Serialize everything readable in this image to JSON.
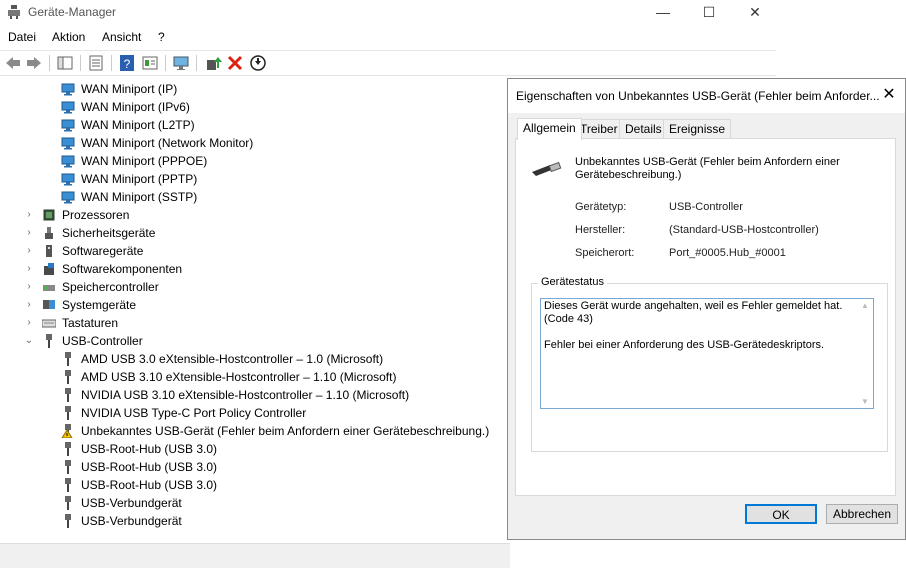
{
  "window": {
    "title": "Geräte-Manager",
    "controls": {
      "minimize": "—",
      "maximize": "☐",
      "close": "✕"
    }
  },
  "menu": [
    "Datei",
    "Aktion",
    "Ansicht",
    "?"
  ],
  "toolbar": [
    "back-icon",
    "forward-icon",
    "properties-icon",
    "console-tree-icon",
    "help-icon",
    "view-icon",
    "monitor-icon",
    "update-driver-icon",
    "uninstall-icon",
    "disable-icon"
  ],
  "tree": [
    {
      "label": "WAN Miniport (IP)",
      "icon": "network-adapter-icon",
      "level": 2
    },
    {
      "label": "WAN Miniport (IPv6)",
      "icon": "network-adapter-icon",
      "level": 2
    },
    {
      "label": "WAN Miniport (L2TP)",
      "icon": "network-adapter-icon",
      "level": 2
    },
    {
      "label": "WAN Miniport (Network Monitor)",
      "icon": "network-adapter-icon",
      "level": 2
    },
    {
      "label": "WAN Miniport (PPPOE)",
      "icon": "network-adapter-icon",
      "level": 2
    },
    {
      "label": "WAN Miniport (PPTP)",
      "icon": "network-adapter-icon",
      "level": 2
    },
    {
      "label": "WAN Miniport (SSTP)",
      "icon": "network-adapter-icon",
      "level": 2
    },
    {
      "label": "Prozessoren",
      "icon": "processor-icon",
      "level": 1,
      "expander": "›"
    },
    {
      "label": "Sicherheitsgeräte",
      "icon": "security-device-icon",
      "level": 1,
      "expander": "›"
    },
    {
      "label": "Softwaregeräte",
      "icon": "software-device-icon",
      "level": 1,
      "expander": "›"
    },
    {
      "label": "Softwarekomponenten",
      "icon": "software-component-icon",
      "level": 1,
      "expander": "›"
    },
    {
      "label": "Speichercontroller",
      "icon": "storage-controller-icon",
      "level": 1,
      "expander": "›"
    },
    {
      "label": "Systemgeräte",
      "icon": "system-device-icon",
      "level": 1,
      "expander": "›"
    },
    {
      "label": "Tastaturen",
      "icon": "keyboard-icon",
      "level": 1,
      "expander": "›"
    },
    {
      "label": "USB-Controller",
      "icon": "usb-icon",
      "level": 1,
      "expander": "⌄"
    },
    {
      "label": "AMD USB 3.0 eXtensible-Hostcontroller – 1.0 (Microsoft)",
      "icon": "usb-icon",
      "level": 2
    },
    {
      "label": "AMD USB 3.10 eXtensible-Hostcontroller – 1.10 (Microsoft)",
      "icon": "usb-icon",
      "level": 2
    },
    {
      "label": "NVIDIA USB 3.10 eXtensible-Hostcontroller – 1.10 (Microsoft)",
      "icon": "usb-icon",
      "level": 2
    },
    {
      "label": "NVIDIA USB Type-C Port Policy Controller",
      "icon": "usb-icon",
      "level": 2
    },
    {
      "label": "Unbekanntes USB-Gerät (Fehler beim Anfordern einer Gerätebeschreibung.)",
      "icon": "warning-usb-icon",
      "level": 2
    },
    {
      "label": "USB-Root-Hub (USB 3.0)",
      "icon": "usb-icon",
      "level": 2
    },
    {
      "label": "USB-Root-Hub (USB 3.0)",
      "icon": "usb-icon",
      "level": 2
    },
    {
      "label": "USB-Root-Hub (USB 3.0)",
      "icon": "usb-icon",
      "level": 2
    },
    {
      "label": "USB-Verbundgerät",
      "icon": "usb-icon",
      "level": 2
    },
    {
      "label": "USB-Verbundgerät",
      "icon": "usb-icon",
      "level": 2
    }
  ],
  "dialog": {
    "title": "Eigenschaften von Unbekanntes USB-Gerät (Fehler beim Anforder...",
    "close": "✕",
    "tabs": [
      "Allgemein",
      "Treiber",
      "Details",
      "Ereignisse"
    ],
    "active_tab": "Allgemein",
    "device_name": "Unbekanntes USB-Gerät (Fehler beim Anfordern einer Gerätebeschreibung.)",
    "props": [
      {
        "label": "Gerätetyp:",
        "value": "USB-Controller"
      },
      {
        "label": "Hersteller:",
        "value": "(Standard-USB-Hostcontroller)"
      },
      {
        "label": "Speicherort:",
        "value": "Port_#0005.Hub_#0001"
      }
    ],
    "status_legend": "Gerätestatus",
    "status_line1": "Dieses Gerät wurde angehalten, weil es Fehler gemeldet hat.",
    "status_line2": "(Code 43)",
    "status_line3": "Fehler bei einer Anforderung des USB-Gerätedeskriptors.",
    "ok": "OK",
    "cancel": "Abbrechen"
  }
}
